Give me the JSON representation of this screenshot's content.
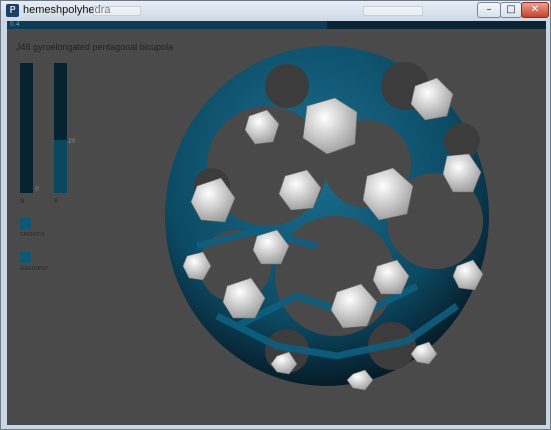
{
  "window": {
    "title": "hemeshpolyhedra",
    "app_icon": "processing-icon"
  },
  "controls": {
    "minimize": "–",
    "maximize": "□",
    "close": "✕"
  },
  "topbar": {
    "value": "0.4",
    "fill_fraction": 0.6
  },
  "polyhedron_name": "J46 gyroelongated pentagonal bicupola",
  "sliders": [
    {
      "label": "N",
      "value": "0",
      "fill_fraction": 0.0
    },
    {
      "label": "R",
      "value": "20",
      "fill_fraction": 0.37
    }
  ],
  "toggles": [
    {
      "label": "SMOOTH",
      "color": "#0f5772"
    },
    {
      "label": "GRADIENT",
      "color": "#0f5772"
    }
  ],
  "colors": {
    "background": "#4a4a4a",
    "accent": "#0d6585",
    "face": "#e6e6e6",
    "dark": "#0a1820"
  }
}
